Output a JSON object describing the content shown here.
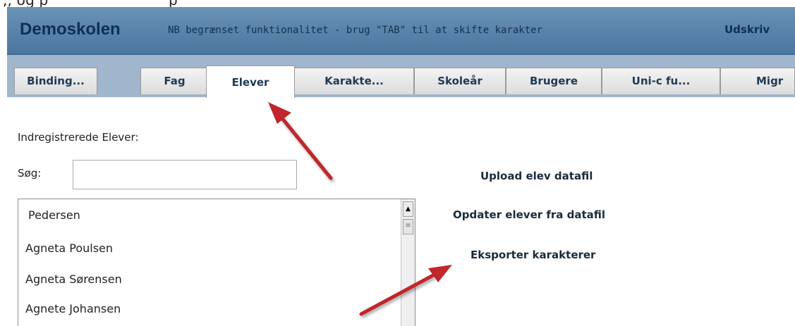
{
  "header": {
    "brand": "Demoskolen",
    "notice": "NB begrænset funktionalitet - brug \"TAB\" til at skifte karakter",
    "print_label": "Udskriv"
  },
  "tabs": [
    {
      "label": "Binding...",
      "active": false
    },
    {
      "label": "Fag",
      "active": false
    },
    {
      "label": "Elever",
      "active": true
    },
    {
      "label": "Karakte...",
      "active": false
    },
    {
      "label": "Skoleår",
      "active": false
    },
    {
      "label": "Brugere",
      "active": false
    },
    {
      "label": "Uni-c fu...",
      "active": false
    },
    {
      "label": "Migr",
      "active": false
    }
  ],
  "students_panel": {
    "label": "Indregistrerede Elever:",
    "search_label": "Søg:",
    "search_value": "",
    "students": [
      "Pedersen",
      "Agneta Poulsen",
      "Agneta Sørensen",
      "Agnete Johansen"
    ]
  },
  "actions": {
    "upload": "Upload elev datafil",
    "update": "Opdater elever fra datafil",
    "export": "Eksporter karakterer"
  },
  "colors": {
    "header": "#5781a9",
    "tabbar": "#9fb6cc",
    "annotation_arrow": "#c0262b"
  },
  "icons": {
    "scroll_up": "triangle-up-icon",
    "scroll_thumb": "grip-icon"
  }
}
